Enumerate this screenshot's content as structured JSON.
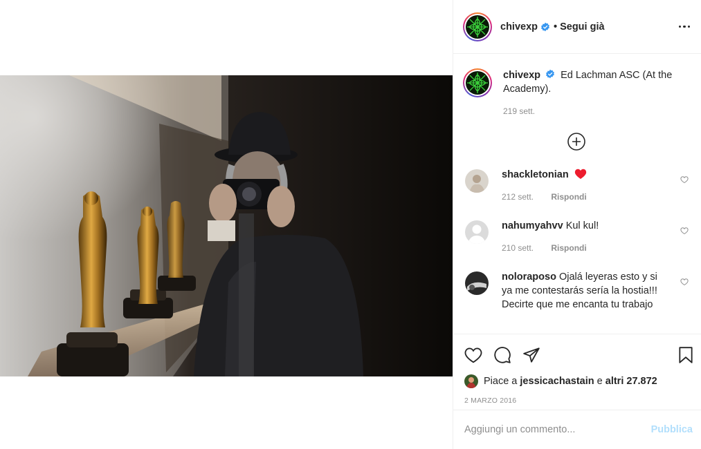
{
  "post": {
    "photo_icon": "photo-oscars-camera"
  },
  "header": {
    "username": "chivexp",
    "separator": "•",
    "follow_label": "Segui già",
    "more_icon": "more-dots-icon"
  },
  "caption": {
    "username": "chivexp",
    "text": "Ed Lachman ASC (At the Academy).",
    "time": "219 sett."
  },
  "load_more_icon": "plus-circle-icon",
  "comments": [
    {
      "username": "shackletonian",
      "text": "",
      "emoji": "red-heart",
      "time": "212 sett.",
      "reply": "Rispondi"
    },
    {
      "username": "nahumyahvv",
      "text": "Kul kul!",
      "time": "210 sett.",
      "reply": "Rispondi"
    },
    {
      "username": "noloraposo",
      "text": "Ojalá leyeras esto y si ya me contestarás sería la hostia!!! Decirte que me encanta tu trabajo",
      "time": "",
      "reply": ""
    }
  ],
  "likes": {
    "prefix": "Piace a",
    "user": "jessicachastain",
    "conj": "e",
    "others": "altri 27.872"
  },
  "date": "2 MARZO 2016",
  "add_comment": {
    "placeholder": "Aggiungi un commento...",
    "post_label": "Pubblica"
  },
  "colors": {
    "accent": "#0095f6",
    "post_disabled": "#b2dffc",
    "verified": "#3897f0",
    "heart": "#ed4956",
    "meta": "#8e8e8e"
  }
}
